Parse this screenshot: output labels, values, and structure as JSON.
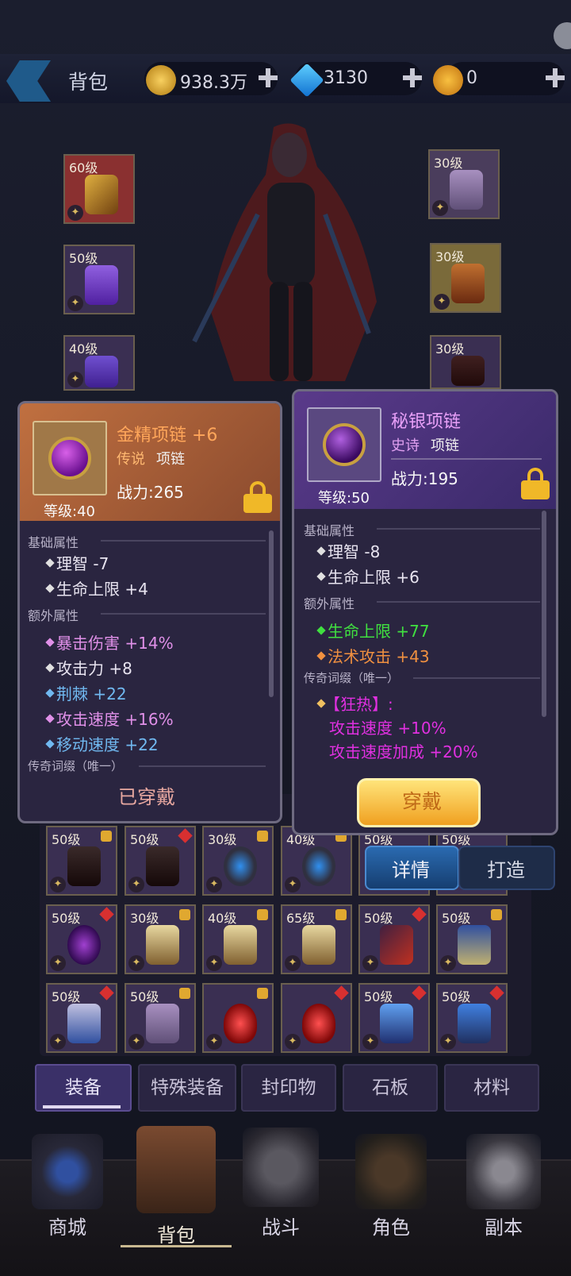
{
  "header": {
    "title": "背包",
    "gold": "938.3万",
    "diamond": "3130",
    "crown": "0"
  },
  "character_slots": {
    "left": [
      {
        "level": "60级"
      },
      {
        "level": "50级"
      },
      {
        "level": "40级"
      }
    ],
    "right": [
      {
        "level": "30级"
      },
      {
        "level": "30级"
      },
      {
        "level": "30级"
      }
    ]
  },
  "panel_equipped": {
    "name": "金精项链 +6",
    "quality": "传说",
    "type": "项链",
    "power": "战力:265",
    "level": "等级:40",
    "basic_title": "基础属性",
    "basic": [
      "理智 -7",
      "生命上限 +4"
    ],
    "extra_title": "额外属性",
    "extra": [
      "暴击伤害 +14%",
      "攻击力 +8",
      "荆棘 +22",
      "攻击速度 +16%",
      "移动速度 +22"
    ],
    "legend_title": "传奇词缀（唯一）",
    "status": "已穿戴"
  },
  "panel_compare": {
    "name": "秘银项链",
    "quality": "史诗",
    "type": "项链",
    "power": "战力:195",
    "level": "等级:50",
    "basic_title": "基础属性",
    "basic": [
      "理智 -8",
      "生命上限 +6"
    ],
    "extra_title": "额外属性",
    "extra": [
      "生命上限 +77",
      "法术攻击 +43"
    ],
    "legend_title": "传奇词缀（唯一）",
    "legend_name": "【狂热】:",
    "legend_lines": [
      "攻击速度 +10%",
      "攻击速度加成 +20%"
    ],
    "wear_button": "穿戴"
  },
  "side_buttons": {
    "detail": "详情",
    "forge": "打造"
  },
  "grid_rows": [
    [
      "50级",
      "50级",
      "30级",
      "40级",
      "50级",
      "50级"
    ],
    [
      "50级",
      "30级",
      "40级",
      "65级",
      "50级",
      "50级"
    ],
    [
      "50级",
      "50级",
      "",
      "",
      "50级",
      "50级"
    ]
  ],
  "tabs": [
    "装备",
    "特殊装备",
    "封印物",
    "石板",
    "材料"
  ],
  "bottom_nav": [
    "商城",
    "背包",
    "战斗",
    "角色",
    "副本"
  ],
  "colors": {
    "legend_orange": "#f0a060",
    "epic_purple": "#d070f0",
    "green_stat": "#40e040",
    "orange_stat": "#f09040",
    "pink_stat": "#e090e8",
    "blue_stat": "#70b8f0",
    "magenta": "#e030e0"
  }
}
